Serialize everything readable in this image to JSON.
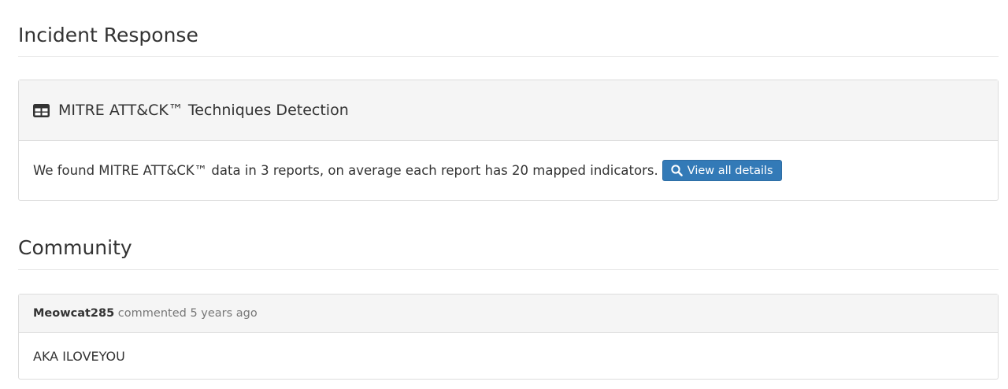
{
  "incident_response": {
    "title": "Incident Response",
    "mitre_panel": {
      "icon": "table-icon",
      "title": "MITRE ATT&CK™ Techniques Detection",
      "body_text": "We found MITRE ATT&CK™ data in 3 reports, on average each report has 20 mapped indicators.",
      "button": {
        "icon": "search-icon",
        "label": "View all details",
        "color": "#337ab7"
      }
    }
  },
  "community": {
    "title": "Community",
    "comments": [
      {
        "author": "Meowcat285",
        "action": " commented ",
        "time": "5 years ago",
        "text": "AKA ILOVEYOU"
      }
    ]
  }
}
